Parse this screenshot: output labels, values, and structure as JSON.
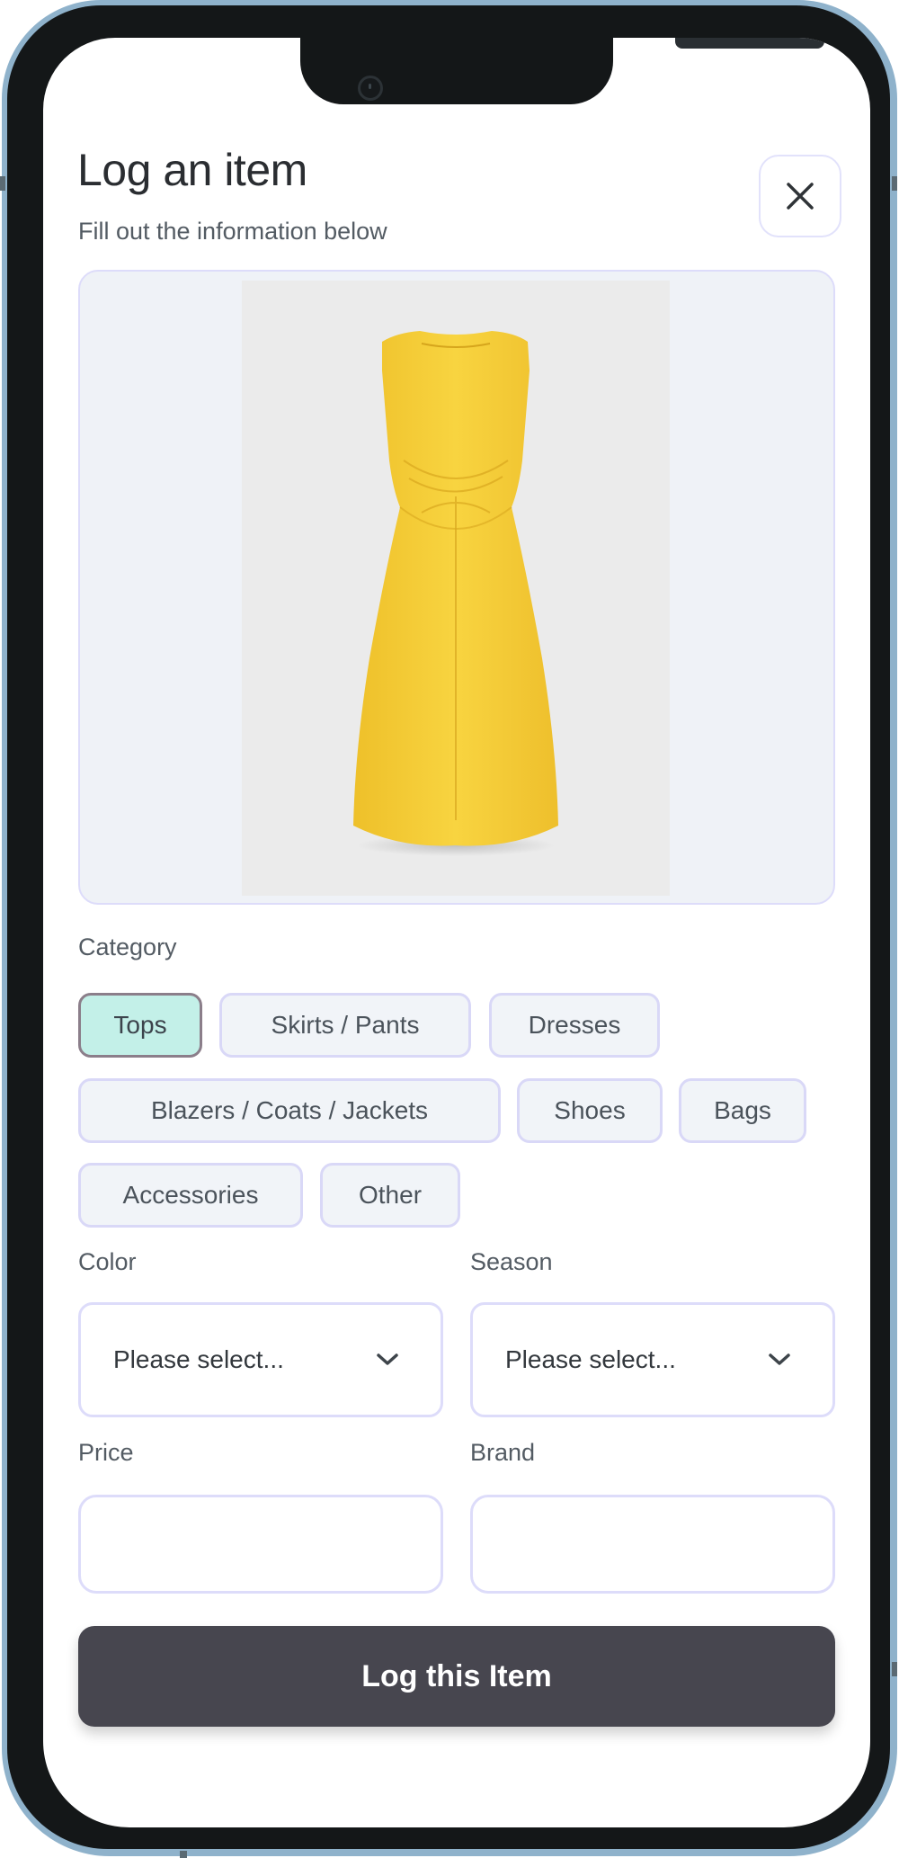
{
  "header": {
    "title": "Log an item",
    "subtitle": "Fill out the information below",
    "close_icon": "close-icon"
  },
  "item_image": {
    "alt": "Yellow sleeveless twist-front midi dress",
    "accent_color": "#f5cd3a"
  },
  "category": {
    "label": "Category",
    "selected": "Tops",
    "options": [
      {
        "label": "Tops",
        "selected": true
      },
      {
        "label": "Skirts / Pants",
        "selected": false
      },
      {
        "label": "Dresses",
        "selected": false
      },
      {
        "label": "Blazers / Coats / Jackets",
        "selected": false
      },
      {
        "label": "Shoes",
        "selected": false
      },
      {
        "label": "Bags",
        "selected": false
      },
      {
        "label": "Accessories",
        "selected": false
      },
      {
        "label": "Other",
        "selected": false
      }
    ]
  },
  "color_field": {
    "label": "Color",
    "value": "Please select...",
    "icon": "chevron-down-icon"
  },
  "season_field": {
    "label": "Season",
    "value": "Please select...",
    "icon": "chevron-down-icon"
  },
  "price_field": {
    "label": "Price",
    "value": ""
  },
  "brand_field": {
    "label": "Brand",
    "value": ""
  },
  "submit": {
    "label": "Log this Item"
  },
  "colors": {
    "selected_chip_bg": "#c3f0e8",
    "chip_border": "#d9d8f7",
    "button_bg": "#47464f"
  }
}
